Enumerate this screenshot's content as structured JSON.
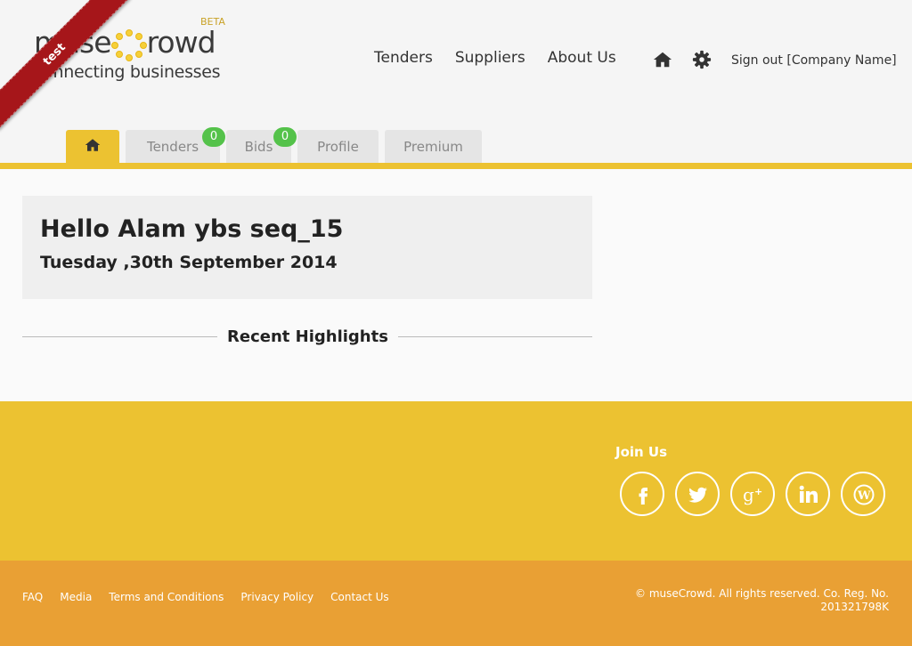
{
  "brand": {
    "name_left": "muse",
    "name_right": "rowd",
    "beta": "BETA",
    "tagline": "connecting businesses",
    "ribbon": "test"
  },
  "nav": {
    "items": [
      {
        "label": "Tenders"
      },
      {
        "label": "Suppliers"
      },
      {
        "label": "About Us"
      }
    ],
    "signout": "Sign out [Company Name]"
  },
  "tabs": [
    {
      "label": "",
      "icon": "home-icon",
      "active": true
    },
    {
      "label": "Tenders",
      "badge": "0"
    },
    {
      "label": "Bids",
      "badge": "0"
    },
    {
      "label": "Profile"
    },
    {
      "label": "Premium"
    }
  ],
  "main": {
    "greeting": "Hello Alam ybs seq_15",
    "date": "Tuesday ,30th September 2014",
    "highlights_title": "Recent Highlights"
  },
  "footer": {
    "join_title": "Join Us",
    "social": [
      "facebook-icon",
      "twitter-icon",
      "google-plus-icon",
      "linkedin-icon",
      "wordpress-icon"
    ],
    "links": [
      "FAQ",
      "Media",
      "Terms and Conditions",
      "Privacy Policy",
      "Contact Us"
    ],
    "copyright_line1": "© museCrowd. All rights reserved. Co. Reg. No.",
    "copyright_line2": "201321798K"
  },
  "colors": {
    "accent_yellow": "#ecc231",
    "footer_orange": "#e9a034",
    "badge_green": "#54c24a",
    "ribbon_red": "#a6161a"
  }
}
